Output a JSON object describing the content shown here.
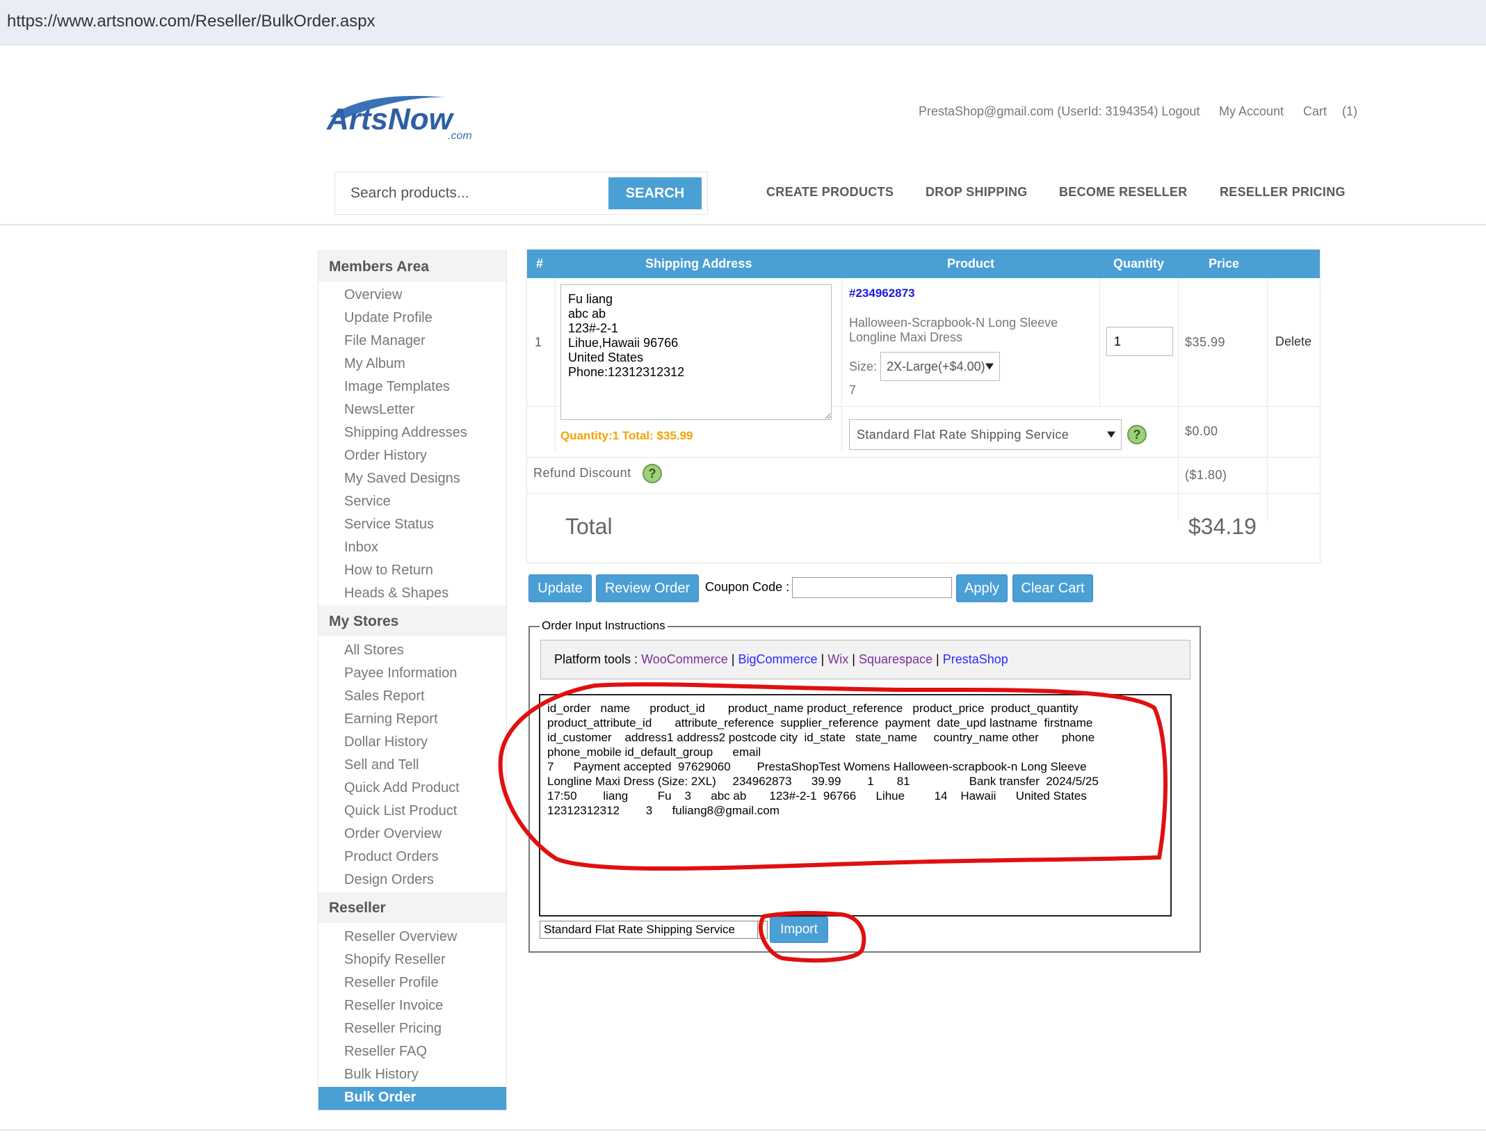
{
  "browser": {
    "url": "https://www.artsnow.com/Reseller/BulkOrder.aspx"
  },
  "header": {
    "logo_text": "ArtsNow",
    "logo_sub": ".com",
    "account_info": "PrestaShop@gmail.com (UserId: 3194354) Logout",
    "my_account": "My Account",
    "cart": "Cart",
    "cart_count": "(1)",
    "search_placeholder": "Search products...",
    "search_button": "SEARCH",
    "nav": [
      "CREATE PRODUCTS",
      "DROP SHIPPING",
      "BECOME RESELLER",
      "RESELLER PRICING"
    ]
  },
  "sidebar": {
    "sections": [
      {
        "title": "Members Area",
        "items": [
          "Overview",
          "Update Profile",
          "File Manager",
          "My Album",
          "Image Templates",
          "NewsLetter",
          "Shipping Addresses",
          "Order History",
          "My Saved Designs",
          "Service",
          "Service Status",
          "Inbox",
          "How to Return",
          "Heads & Shapes"
        ]
      },
      {
        "title": "My Stores",
        "items": [
          "All Stores",
          "Payee Information",
          "Sales Report",
          "Earning Report",
          "Dollar History",
          "Sell and Tell",
          "Quick Add Product",
          "Quick List Product",
          "Order Overview",
          "Product Orders",
          "Design Orders"
        ]
      },
      {
        "title": "Reseller",
        "items": [
          "Reseller Overview",
          "Shopify Reseller",
          "Reseller Profile",
          "Reseller Invoice",
          "Reseller Pricing",
          "Reseller FAQ",
          "Bulk History"
        ]
      }
    ],
    "active_item": "Bulk Order"
  },
  "cart": {
    "columns": [
      "#",
      "Shipping Address",
      "Product",
      "Quantity",
      "Price"
    ],
    "row": {
      "index": "1",
      "address": "Fu liang\nabc ab\n123#-2-1\nLihue,Hawaii 96766\nUnited States\nPhone:12312312312",
      "product_id": "#234962873",
      "product_name_line1": "Halloween-Scrapbook-N Long Sleeve",
      "product_name_line2": "Longline Maxi Dress",
      "size_label": "Size:",
      "size_value": "2X-Large(+$4.00)",
      "product_extra": "7",
      "quantity": "1",
      "price": "$35.99",
      "delete": "Delete",
      "summary": "Quantity:1 Total: $35.99",
      "shipping_service": "Standard Flat Rate Shipping Service",
      "shipping_price": "$0.00"
    },
    "refund_label": "Refund Discount",
    "refund_value": "($1.80)",
    "total_label": "Total",
    "total_value": "$34.19",
    "help_glyph": "?"
  },
  "actions": {
    "update": "Update",
    "review_order": "Review Order",
    "coupon_label": "Coupon Code :",
    "apply": "Apply",
    "clear_cart": "Clear Cart"
  },
  "instructions": {
    "legend": "Order Input Instructions",
    "platform_label": "Platform tools :",
    "platforms": [
      "WooCommerce",
      "BigCommerce",
      "Wix",
      "Squarespace",
      "PrestaShop"
    ],
    "separator": "|",
    "order_text": "id_order   name      product_id       product_name product_reference   product_price  product_quantity\nproduct_attribute_id       attribute_reference  supplier_reference  payment  date_upd lastname  firstname\nid_customer    address1 address2 postcode city  id_state   state_name     country_name other       phone\nphone_mobile id_default_group      email\n7      Payment accepted  97629060        PrestaShopTest Womens Halloween-scrapbook-n Long Sleeve\nLongline Maxi Dress (Size: 2XL)     234962873      39.99        1       81                  Bank transfer  2024/5/25\n17:50        liang         Fu    3      abc ab       123#-2-1  96766      Lihue         14    Hawaii      United States\n12312312312        3      fuliang8@gmail.com",
    "shipping_select": "Standard Flat Rate Shipping Service",
    "import": "Import"
  },
  "colors": {
    "accent": "#4a9fd5",
    "link": "#2a2aff",
    "orange": "#f4a300",
    "annotation": "#e01010"
  }
}
